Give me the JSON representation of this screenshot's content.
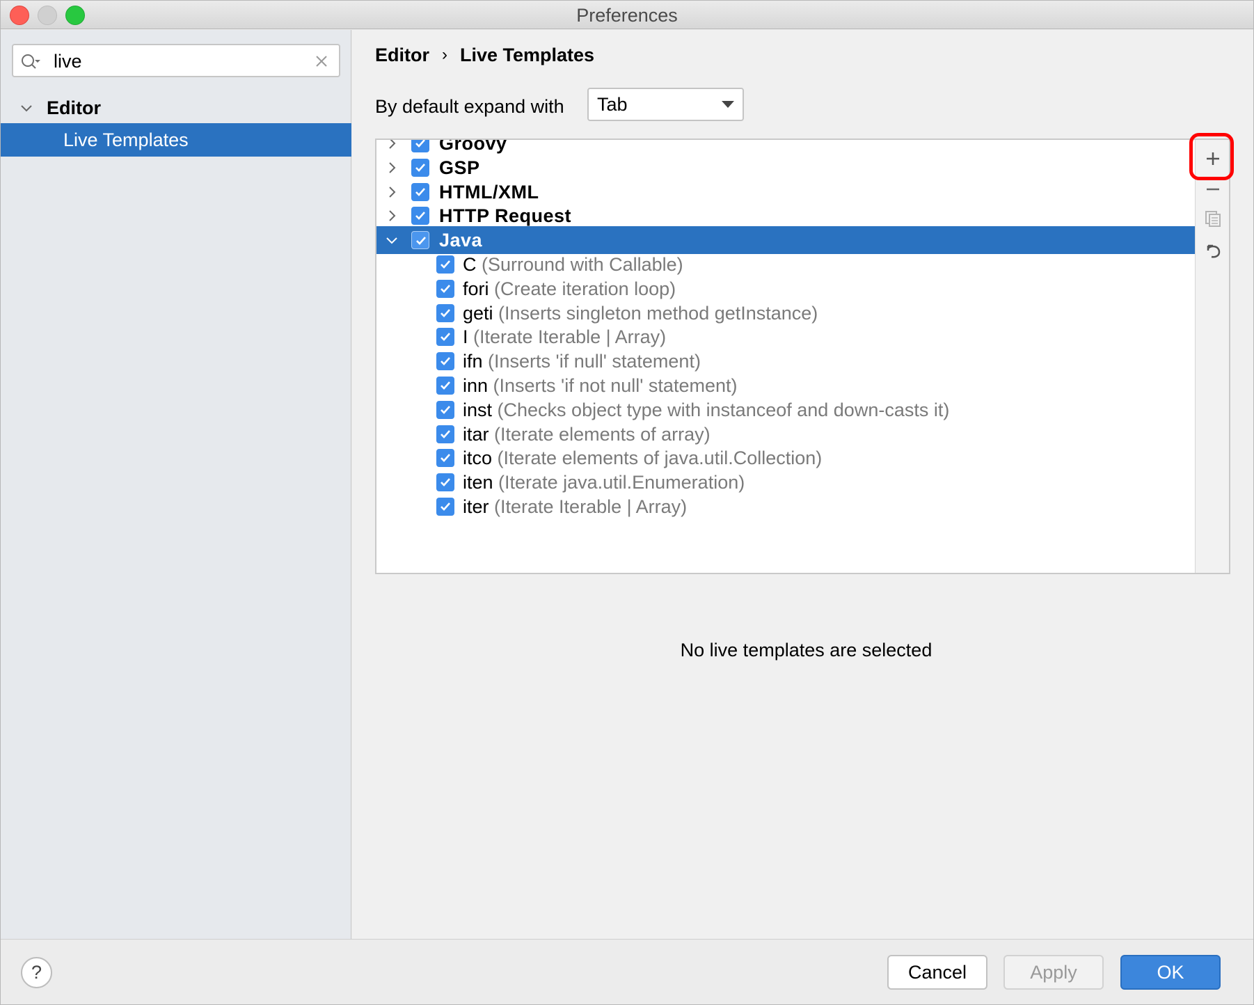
{
  "window": {
    "title": "Preferences"
  },
  "sidebar": {
    "search": {
      "value": "live"
    },
    "tree": {
      "editor_label": "Editor",
      "selected_item": "Live Templates"
    }
  },
  "main": {
    "breadcrumb": {
      "parent": "Editor",
      "separator": "›",
      "current": "Live Templates"
    },
    "expand": {
      "label": "By default expand with",
      "selected": "Tab"
    },
    "groups": [
      {
        "name": "Groovy",
        "checked": true,
        "expanded": false
      },
      {
        "name": "GSP",
        "checked": true,
        "expanded": false
      },
      {
        "name": "HTML/XML",
        "checked": true,
        "expanded": false
      },
      {
        "name": "HTTP Request",
        "checked": true,
        "expanded": false
      },
      {
        "name": "Java",
        "checked": true,
        "expanded": true,
        "selected": true
      }
    ],
    "templates": [
      {
        "abbr": "C",
        "desc": "(Surround with Callable)"
      },
      {
        "abbr": "fori",
        "desc": "(Create iteration loop)"
      },
      {
        "abbr": "geti",
        "desc": "(Inserts singleton method getInstance)"
      },
      {
        "abbr": "I",
        "desc": "(Iterate Iterable | Array)"
      },
      {
        "abbr": "ifn",
        "desc": "(Inserts 'if null' statement)"
      },
      {
        "abbr": "inn",
        "desc": "(Inserts 'if not null' statement)"
      },
      {
        "abbr": "inst",
        "desc": "(Checks object type with instanceof and down-casts it)"
      },
      {
        "abbr": "itar",
        "desc": "(Iterate elements of array)"
      },
      {
        "abbr": "itco",
        "desc": "(Iterate elements of java.util.Collection)"
      },
      {
        "abbr": "iten",
        "desc": "(Iterate java.util.Enumeration)"
      },
      {
        "abbr": "iter",
        "desc": "(Iterate Iterable | Array)"
      }
    ],
    "toolbar_icons": [
      "add-icon",
      "remove-icon",
      "copy-icon",
      "restore-icon"
    ],
    "empty_message": "No live templates are selected"
  },
  "buttons": {
    "help": "?",
    "cancel": "Cancel",
    "apply": "Apply",
    "ok": "OK"
  },
  "colors": {
    "accent": "#2a72c0",
    "checkbox": "#3b8beb",
    "highlight": "#ff0000"
  }
}
